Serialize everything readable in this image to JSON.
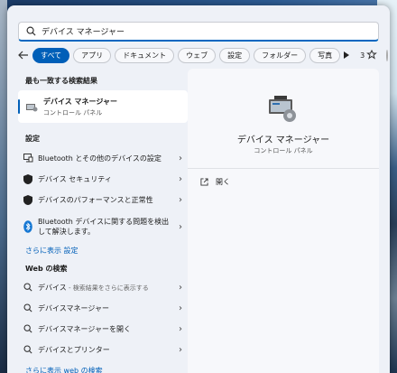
{
  "search": {
    "value": "デバイス マネージャー",
    "placeholder": ""
  },
  "filters": [
    "すべて",
    "アプリ",
    "ドキュメント",
    "ウェブ",
    "設定",
    "フォルダー",
    "写真"
  ],
  "rewards_count": "3",
  "best_match": {
    "heading": "最も一致する検索結果",
    "title": "デバイス マネージャー",
    "subtitle": "コントロール パネル"
  },
  "settings": {
    "heading": "設定",
    "items": [
      {
        "label": "Bluetooth とその他のデバイスの設定"
      },
      {
        "label": "デバイス セキュリティ"
      },
      {
        "label": "デバイスのパフォーマンスと正常性"
      },
      {
        "label": "Bluetooth デバイスに関する問題を検出して解決します。"
      }
    ],
    "more": "さらに表示 設定"
  },
  "web": {
    "heading": "Web の検索",
    "items": [
      {
        "label": "デバイス",
        "suffix": " - 検索結果をさらに表示する"
      },
      {
        "label": "デバイスマネージャー",
        "suffix": ""
      },
      {
        "label": "デバイスマネージャーを開く",
        "suffix": ""
      },
      {
        "label": "デバイスとプリンター",
        "suffix": ""
      }
    ],
    "more": "さらに表示 web の検索"
  },
  "detail": {
    "title": "デバイス マネージャー",
    "subtitle": "コントロール パネル",
    "action": "開く"
  },
  "colors": {
    "accent": "#005fb8"
  }
}
